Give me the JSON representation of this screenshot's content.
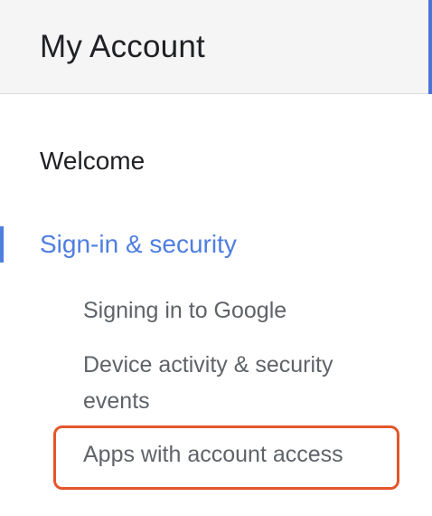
{
  "header": {
    "title": "My Account"
  },
  "nav": {
    "welcome_label": "Welcome",
    "security_label": "Sign-in & security",
    "sub_items": [
      {
        "label": "Signing in to Google"
      },
      {
        "label": "Device activity & security events"
      },
      {
        "label": "Apps with account access"
      }
    ]
  },
  "colors": {
    "accent": "#4f7ee0",
    "highlight": "#e3562b"
  }
}
